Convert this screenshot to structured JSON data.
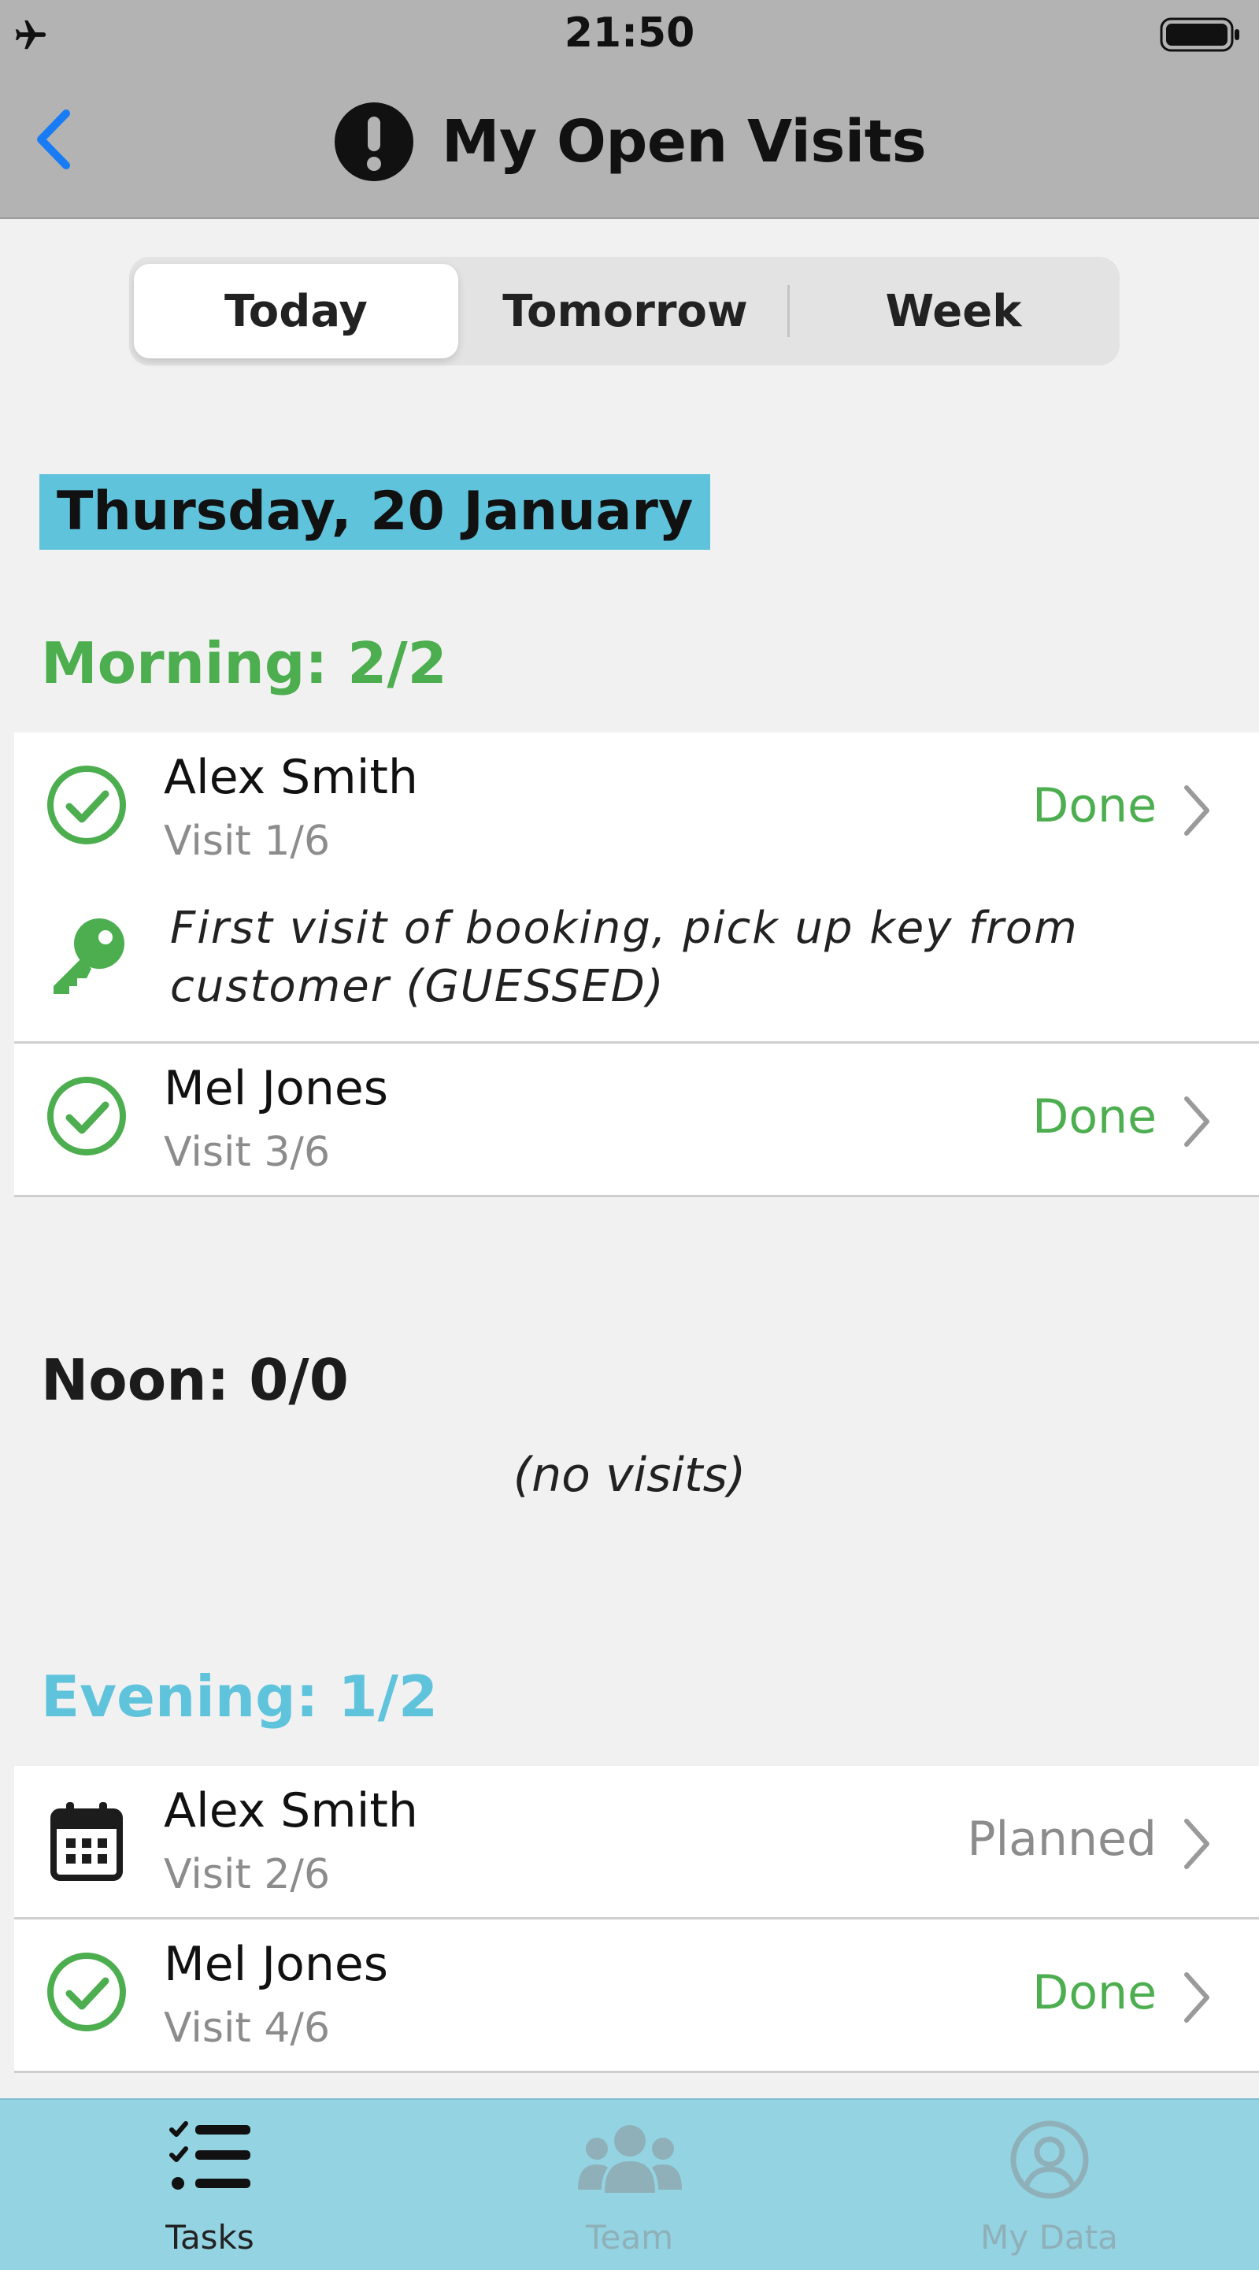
{
  "status_bar": {
    "time": "21:50",
    "airplane_icon": "airplane-icon",
    "battery_icon": "battery-icon"
  },
  "header": {
    "title": "My Open Visits",
    "back_icon": "chevron-left-icon",
    "alert_icon": "exclamation-circle-icon"
  },
  "segments": {
    "items": [
      "Today",
      "Tomorrow",
      "Week"
    ],
    "selected": "Today"
  },
  "date_heading": "Thursday, 20 January",
  "sections": {
    "morning": {
      "title": "Morning: 2/2",
      "color": "#4cae4f",
      "visits": [
        {
          "name": "Alex Smith",
          "visit": "Visit 1/6",
          "status": "Done",
          "icon": "check-circle-icon",
          "note": "First visit of booking, pick up key from customer (GUESSED)",
          "note_icon": "key-icon"
        },
        {
          "name": "Mel Jones",
          "visit": "Visit 3/6",
          "status": "Done",
          "icon": "check-circle-icon"
        }
      ]
    },
    "noon": {
      "title": "Noon: 0/0",
      "color": "#1c1c1c",
      "empty_text": "(no visits)"
    },
    "evening": {
      "title": "Evening: 1/2",
      "color": "#60c3dc",
      "visits": [
        {
          "name": "Alex Smith",
          "visit": "Visit 2/6",
          "status": "Planned",
          "icon": "calendar-icon"
        },
        {
          "name": "Mel Jones",
          "visit": "Visit 4/6",
          "status": "Done",
          "icon": "check-circle-icon"
        }
      ]
    }
  },
  "tab_bar": {
    "tasks": "Tasks",
    "team": "Team",
    "my_data": "My Data",
    "active": "Tasks"
  },
  "colors": {
    "accent_done": "#4cae4f",
    "accent_header": "#60c3dc",
    "planned": "#8c8c8c",
    "back": "#1a7cf5"
  }
}
